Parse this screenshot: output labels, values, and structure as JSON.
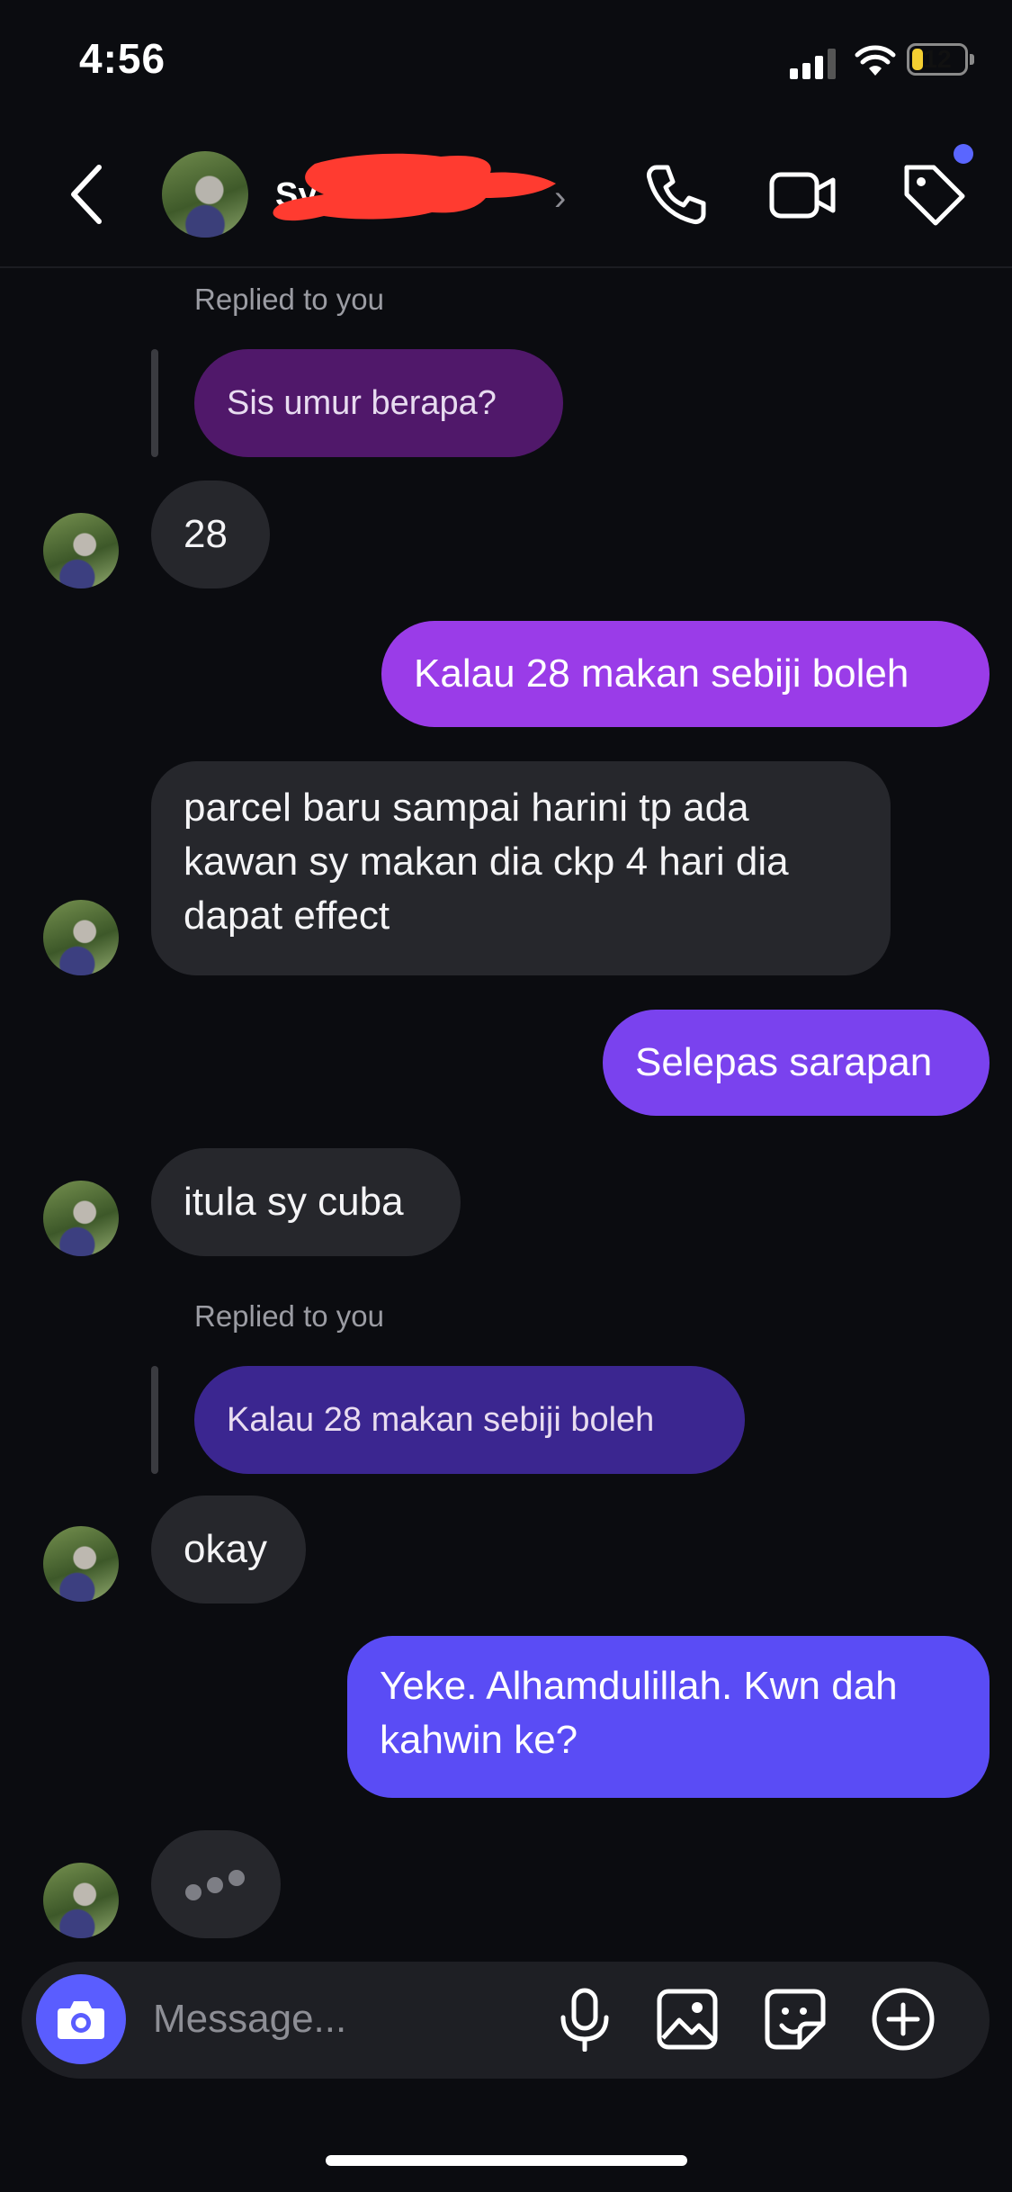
{
  "status_bar": {
    "time": "4:56",
    "battery": "12"
  },
  "header": {
    "contact_name": "Sy..."
  },
  "messages": [
    {
      "type": "reply_label",
      "text": "Replied to you"
    },
    {
      "type": "quoted",
      "text": "Sis umur berapa?"
    },
    {
      "type": "incoming",
      "text": "28"
    },
    {
      "type": "outgoing",
      "text": "Kalau 28 makan sebiji boleh"
    },
    {
      "type": "incoming",
      "text": "parcel baru sampai harini tp ada kawan sy makan dia ckp 4 hari dia dapat effect"
    },
    {
      "type": "outgoing",
      "text": "Selepas sarapan"
    },
    {
      "type": "incoming",
      "text": "itula sy cuba"
    },
    {
      "type": "reply_label",
      "text": "Replied to you"
    },
    {
      "type": "quoted",
      "text": "Kalau 28 makan sebiji boleh"
    },
    {
      "type": "incoming",
      "text": "okay"
    },
    {
      "type": "outgoing",
      "text": "Yeke. Alhamdulillah. Kwn dah kahwin ke?"
    },
    {
      "type": "typing_indicator"
    }
  ],
  "composer": {
    "placeholder": "Message..."
  },
  "icons": [
    "back-chevron-icon",
    "phone-icon",
    "video-camera-icon",
    "tag-icon",
    "camera-icon",
    "microphone-icon",
    "gallery-icon",
    "sticker-icon",
    "plus-circle-icon"
  ],
  "colors": {
    "background": "#0b0c10",
    "incoming_bubble": "#26272c",
    "outgoing_bubble_top": "#a43ee6",
    "outgoing_bubble_bottom": "#5a4cf5",
    "camera_button": "#5a5dff",
    "notification_dot": "#5a66ff"
  }
}
